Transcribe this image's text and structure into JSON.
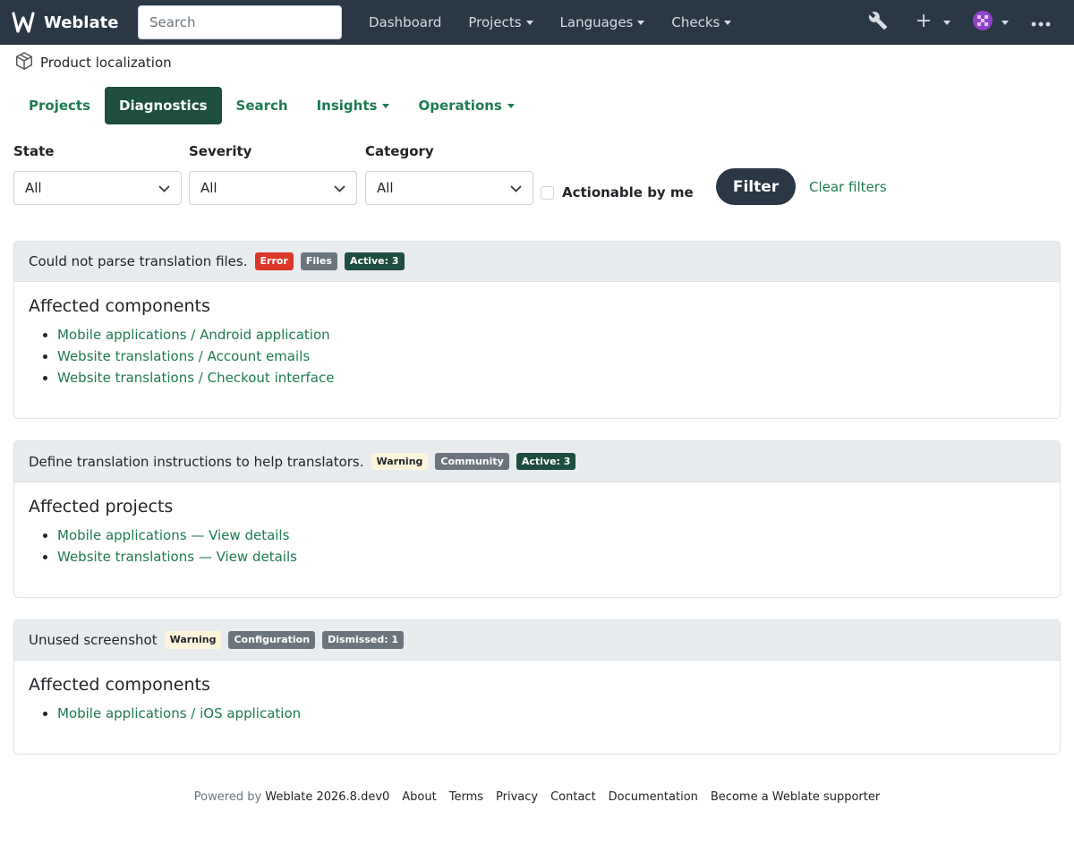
{
  "navbar": {
    "brand": "Weblate",
    "search_placeholder": "Search",
    "links": [
      {
        "label": "Dashboard",
        "dropdown": false
      },
      {
        "label": "Projects",
        "dropdown": true
      },
      {
        "label": "Languages",
        "dropdown": true
      },
      {
        "label": "Checks",
        "dropdown": true
      }
    ]
  },
  "breadcrumb": {
    "label": "Product localization"
  },
  "tabs": [
    {
      "label": "Projects",
      "active": false
    },
    {
      "label": "Diagnostics",
      "active": true
    },
    {
      "label": "Search",
      "active": false
    },
    {
      "label": "Insights",
      "active": false
    },
    {
      "label": "Operations",
      "active": false
    }
  ],
  "filters": {
    "state": {
      "label": "State",
      "value": "All"
    },
    "severity": {
      "label": "Severity",
      "value": "All"
    },
    "category": {
      "label": "Category",
      "value": "All"
    },
    "actionable_label": "Actionable by me",
    "filter_button": "Filter",
    "clear_label": "Clear filters"
  },
  "cards": [
    {
      "title": "Could not parse translation files.",
      "badges": [
        "Error",
        "Files",
        "Active: 3"
      ],
      "section_title": "Affected components",
      "items": [
        {
          "link": "Mobile applications / Android application"
        },
        {
          "link": "Website translations / Account emails"
        },
        {
          "link": "Website translations / Checkout interface"
        }
      ]
    },
    {
      "title": "Define translation instructions to help translators.",
      "badges": [
        "Warning",
        "Community",
        "Active: 3"
      ],
      "section_title": "Affected projects",
      "items": [
        {
          "link": "Mobile applications",
          "sep": " — ",
          "detail": "View details"
        },
        {
          "link": "Website translations",
          "sep": " — ",
          "detail": "View details"
        }
      ]
    },
    {
      "title": "Unused screenshot",
      "badges": [
        "Warning",
        "Configuration",
        "Dismissed: 1"
      ],
      "section_title": "Affected components",
      "items": [
        {
          "link": "Mobile applications / iOS application"
        }
      ]
    }
  ],
  "footer": {
    "powered_by": "Powered by",
    "version": "Weblate 2026.8.dev0",
    "links": [
      "About",
      "Terms",
      "Privacy",
      "Contact",
      "Documentation",
      "Become a Weblate supporter"
    ]
  },
  "colors": {
    "navbar": "#2a3744",
    "accent": "#1f7a50",
    "active_tab": "#1d4e3f",
    "error": "#d9382a"
  }
}
